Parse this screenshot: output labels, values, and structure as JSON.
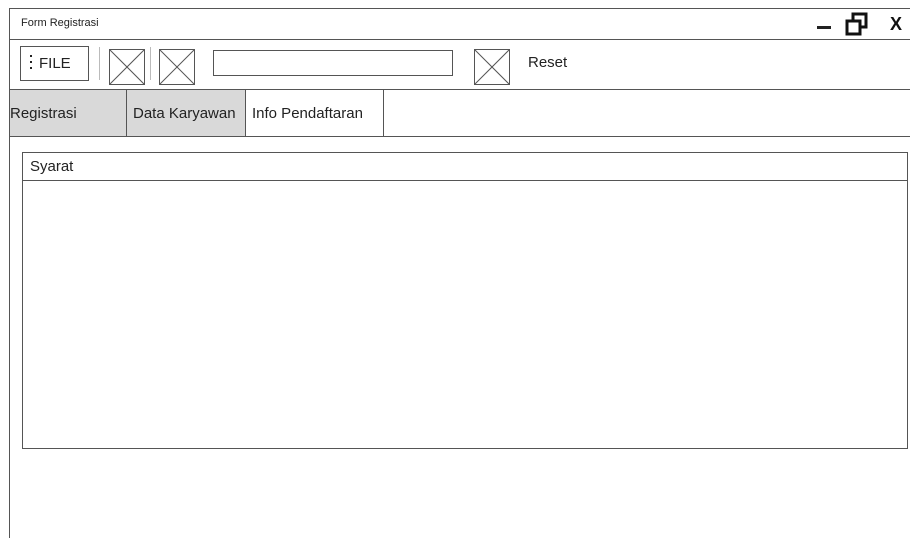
{
  "window": {
    "title": "Form Registrasi",
    "close_label": "X"
  },
  "toolbar": {
    "file_label": "FILE",
    "reset_label": "Reset",
    "address_value": ""
  },
  "tabs": [
    {
      "label": "Registrasi",
      "active": false
    },
    {
      "label": "Data Karyawan",
      "active": false
    },
    {
      "label": "Info Pendaftaran",
      "active": true
    }
  ],
  "panel": {
    "header": "Syarat"
  },
  "colors": {
    "border": "#555555",
    "inactive_tab": "#d9d9d9",
    "background": "#ffffff"
  }
}
